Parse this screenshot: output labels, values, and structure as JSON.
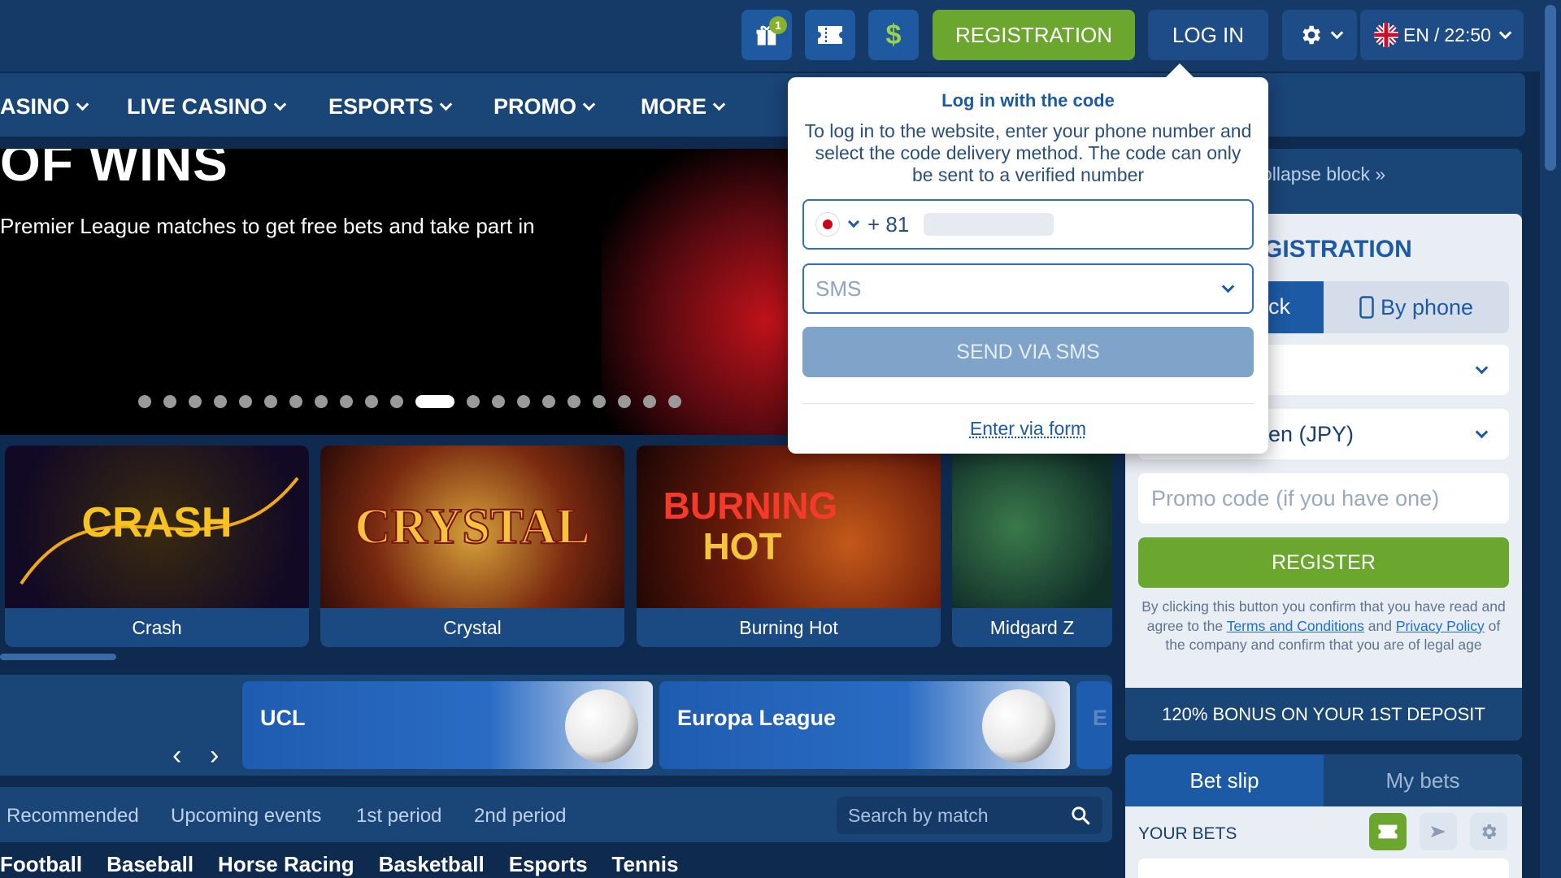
{
  "header": {
    "gift_badge": "1",
    "cash_icon": "$",
    "registration_label": "REGISTRATION",
    "login_label": "LOG IN",
    "language": "EN",
    "separator": "/",
    "time": "22:50"
  },
  "nav": {
    "items": [
      "ASINO",
      "LIVE CASINO",
      "ESPORTS",
      "PROMO",
      "MORE"
    ]
  },
  "banner": {
    "title": "OF WINS",
    "subtitle": "Premier League matches to get free bets and take part in",
    "dot_count": 21,
    "active_dot": 11
  },
  "games": [
    {
      "name": "Crash",
      "color": "#1a1a3a"
    },
    {
      "name": "Crystal",
      "color": "#8a2a14"
    },
    {
      "name": "Burning Hot",
      "color": "#4a1208"
    },
    {
      "name": "Midgard Z",
      "color": "#1f4a3a"
    }
  ],
  "tournaments": {
    "items": [
      "UCL",
      "Europa League",
      "E"
    ],
    "prev_icon": "‹",
    "next_icon": "›"
  },
  "filters": {
    "tabs": [
      "Recommended",
      "Upcoming events",
      "1st period",
      "2nd period"
    ],
    "search_placeholder": "Search by match"
  },
  "sports": [
    "Football",
    "Baseball",
    "Horse Racing",
    "Basketball",
    "Esports",
    "Tennis"
  ],
  "registration": {
    "collapse_label": "ollapse block »",
    "title": "GISTRATION",
    "tab_left": "ck",
    "tab_right": "By phone",
    "currency": "en (JPY)",
    "promo_placeholder": "Promo code (if you have one)",
    "register_label": "REGISTER",
    "terms_prefix": "By clicking this button you confirm that you have read and agree to the ",
    "terms_link": "Terms and Conditions",
    "terms_and": " and ",
    "privacy_link": "Privacy Policy",
    "terms_suffix": " of the company and confirm that you are of legal age",
    "bonus": "120% BONUS ON YOUR 1ST DEPOSIT"
  },
  "betslip": {
    "tab_betslip": "Bet slip",
    "tab_mybets": "My bets",
    "your_bets": "YOUR BETS"
  },
  "login_popup": {
    "title": "Log in with the code",
    "description": "To log in to the website, enter your phone number and select the code delivery method. The code can only be sent to a verified number",
    "country_code": "+ 81",
    "delivery_method": "SMS",
    "send_label": "SEND VIA SMS",
    "form_link": "Enter via form"
  },
  "colors": {
    "background": "#0e2a4e",
    "panel": "#1a4577",
    "accent_green": "#6ba62e",
    "accent_blue": "#1d5aa5"
  }
}
